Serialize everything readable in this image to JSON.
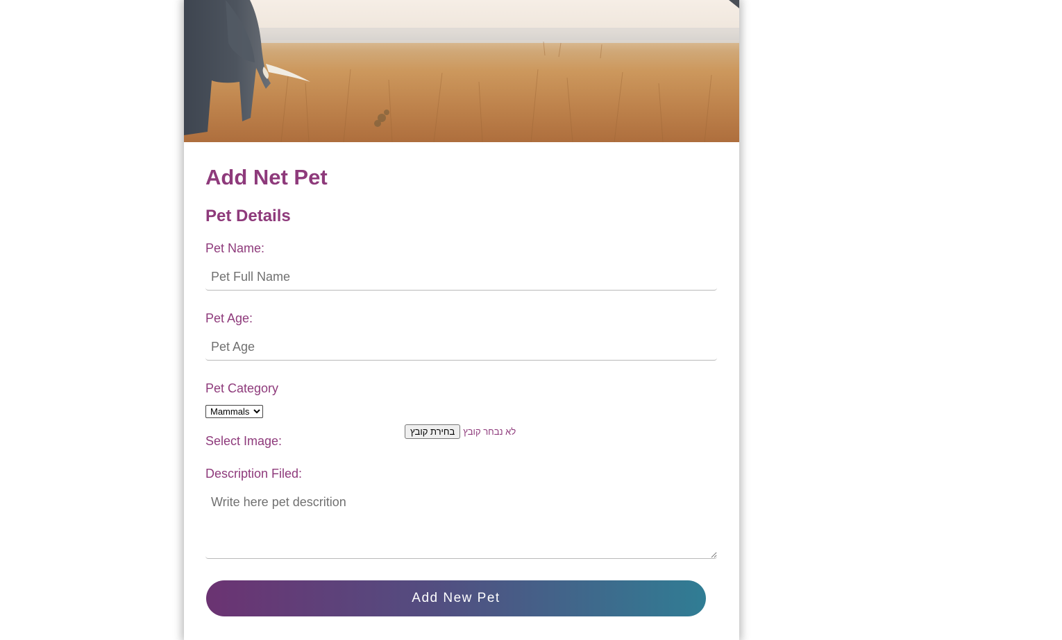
{
  "form": {
    "title": "Add Net Pet",
    "section_title": "Pet Details",
    "name_label": "Pet Name:",
    "name_placeholder": "Pet Full Name",
    "age_label": "Pet Age:",
    "age_placeholder": "Pet Age",
    "category_label": "Pet Category",
    "category_selected": "Mammals",
    "image_label": "Select Image:",
    "file_button": "בחירת קובץ",
    "file_status": "לא נבחר קובץ",
    "description_label": "Description Filed:",
    "description_placeholder": "Write here pet descrition",
    "submit_label": "Add New Pet"
  },
  "colors": {
    "accent": "#8e3a7b",
    "button_gradient_start": "#6b3372",
    "button_gradient_end": "#307d94"
  }
}
